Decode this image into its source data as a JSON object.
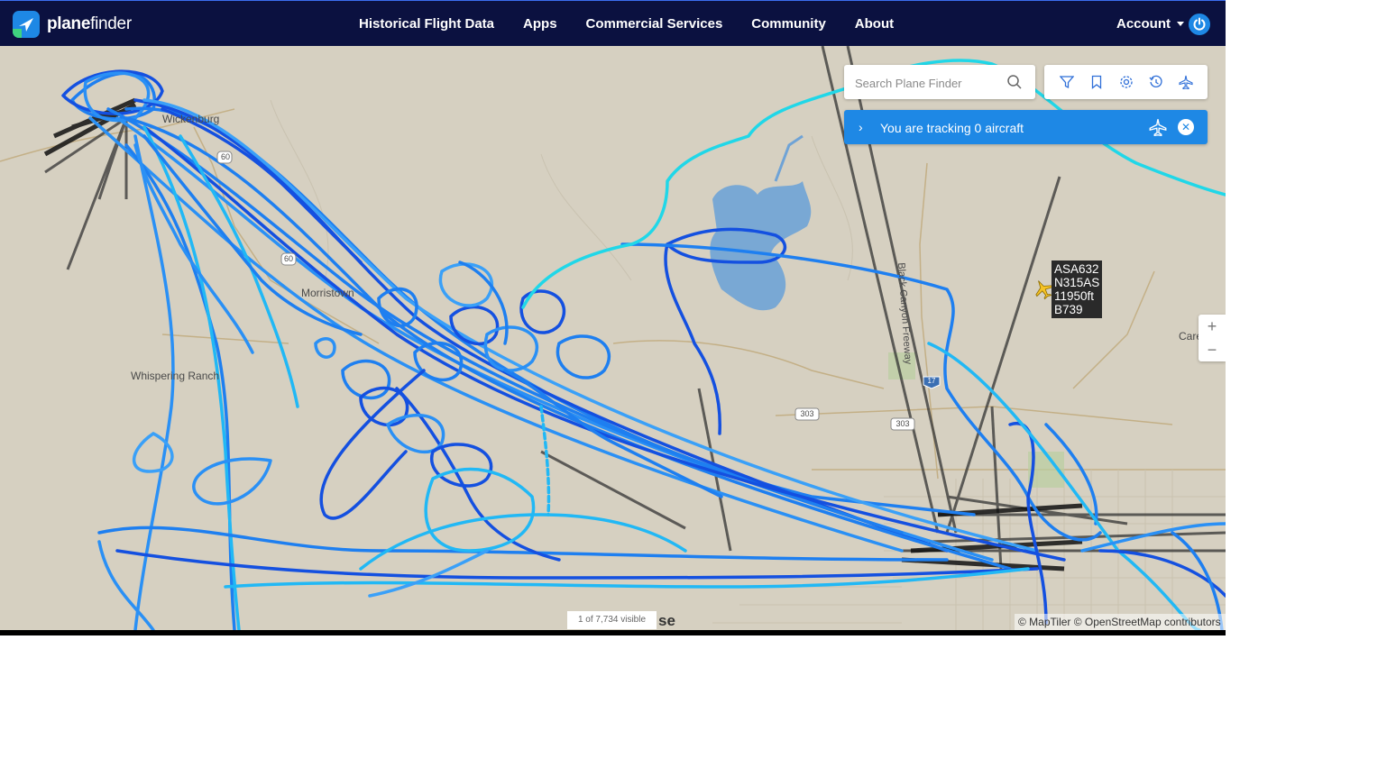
{
  "brand": {
    "plane": "plane",
    "finder": "finder"
  },
  "nav": [
    "Historical Flight Data",
    "Apps",
    "Commercial Services",
    "Community",
    "About"
  ],
  "account": {
    "label": "Account"
  },
  "search": {
    "placeholder": "Search Plane Finder"
  },
  "tracking": {
    "text": "You are tracking 0 aircraft"
  },
  "aircraft": {
    "callsign": "ASA632",
    "registration": "N315AS",
    "altitude": "11950ft",
    "type": "B739"
  },
  "places": {
    "wickenburg": "Wickenburg",
    "morristown": "Morristown",
    "whispering_ranch": "Whispering Ranch",
    "freeway": "Black Canyon Freeway",
    "care": "Care",
    "route60a": "60",
    "route60b": "60",
    "route303a": "303",
    "route303b": "303",
    "route17": "17"
  },
  "map": {
    "visible_count": "1 of 7,734 visible",
    "partial_label": "se",
    "attribution": "© MapTiler © OpenStreetMap contributors"
  },
  "zoom": {
    "in": "+",
    "out": "−"
  },
  "colors": {
    "header": "#0b1140",
    "accent": "#1e88e5",
    "track_dark": "#1450e0",
    "track_mid": "#1e7ff0",
    "track_light": "#21b8f5",
    "track_cyan": "#20d7e8"
  }
}
